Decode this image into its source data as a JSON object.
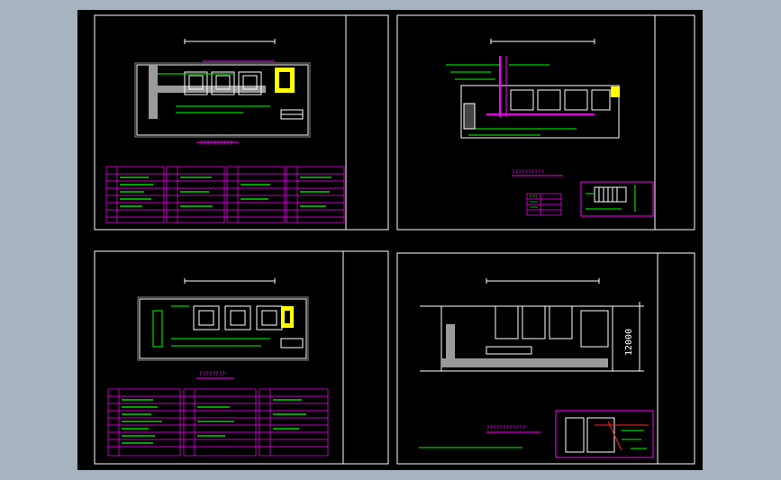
{
  "viewer": {
    "background": "#a7b2bf",
    "sheet_background": "#000000"
  },
  "colors": {
    "frame": "#ffffff",
    "wall": "#ffffff",
    "magenta": "#ff00ff",
    "green": "#00ff00",
    "yellow": "#ffff00",
    "gray": "#9a9a9a",
    "red": "#ff2020"
  },
  "drawings": [
    {
      "name": "plan-1",
      "title": "??????????"
    },
    {
      "name": "plan-2",
      "title": "??????????",
      "legend_title": "????"
    },
    {
      "name": "plan-3",
      "title": "????????"
    },
    {
      "name": "section-4",
      "title": "????????????",
      "dimension": "12000"
    }
  ]
}
